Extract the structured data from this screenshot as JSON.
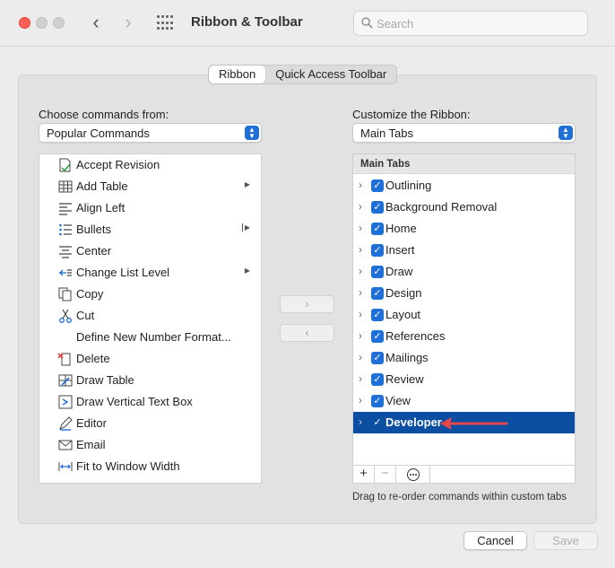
{
  "window": {
    "title": "Ribbon & Toolbar"
  },
  "search": {
    "placeholder": "Search",
    "value": ""
  },
  "segmented": {
    "tabs": [
      "Ribbon",
      "Quick Access Toolbar"
    ],
    "active": "Ribbon"
  },
  "left": {
    "label": "Choose commands from:",
    "popup_value": "Popular Commands",
    "commands": [
      {
        "label": "Accept Revision",
        "icon": "accept-revision-icon",
        "submenu": ""
      },
      {
        "label": "Add Table",
        "icon": "table-icon",
        "submenu": "▶"
      },
      {
        "label": "Align Left",
        "icon": "align-left-icon",
        "submenu": ""
      },
      {
        "label": "Bullets",
        "icon": "bullets-icon",
        "submenu": "▶"
      },
      {
        "label": "Center",
        "icon": "align-center-icon",
        "submenu": ""
      },
      {
        "label": "Change List Level",
        "icon": "list-level-icon",
        "submenu": "▶"
      },
      {
        "label": "Copy",
        "icon": "copy-icon",
        "submenu": ""
      },
      {
        "label": "Cut",
        "icon": "scissors-icon",
        "submenu": ""
      },
      {
        "label": "Define New Number Format...",
        "icon": "",
        "submenu": ""
      },
      {
        "label": "Delete",
        "icon": "delete-icon",
        "submenu": ""
      },
      {
        "label": "Draw Table",
        "icon": "draw-table-icon",
        "submenu": ""
      },
      {
        "label": "Draw Vertical Text Box",
        "icon": "vertical-textbox-icon",
        "submenu": ""
      },
      {
        "label": "Editor",
        "icon": "editor-pen-icon",
        "submenu": ""
      },
      {
        "label": "Email",
        "icon": "email-icon",
        "submenu": ""
      },
      {
        "label": "Fit to Window Width",
        "icon": "fit-width-icon",
        "submenu": ""
      }
    ]
  },
  "right": {
    "label": "Customize the Ribbon:",
    "popup_value": "Main Tabs",
    "tree_header": "Main Tabs",
    "tabs": [
      {
        "label": "Outlining",
        "checked": true
      },
      {
        "label": "Background Removal",
        "checked": true
      },
      {
        "label": "Home",
        "checked": true
      },
      {
        "label": "Insert",
        "checked": true
      },
      {
        "label": "Draw",
        "checked": true
      },
      {
        "label": "Design",
        "checked": true
      },
      {
        "label": "Layout",
        "checked": true
      },
      {
        "label": "References",
        "checked": true
      },
      {
        "label": "Mailings",
        "checked": true
      },
      {
        "label": "Review",
        "checked": true
      },
      {
        "label": "View",
        "checked": true
      },
      {
        "label": "Developer",
        "checked": true,
        "selected": true
      }
    ],
    "toolbar": {
      "add": "+",
      "remove": "−",
      "more": "···"
    },
    "hint": "Drag to re-order commands within custom tabs"
  },
  "move": {
    "add": "›",
    "remove": "‹"
  },
  "footer": {
    "cancel": "Cancel",
    "save": "Save"
  },
  "colors": {
    "accent": "#1f6fd8",
    "selection": "#0b4ea2",
    "annotation_arrow": "#e8474a"
  }
}
